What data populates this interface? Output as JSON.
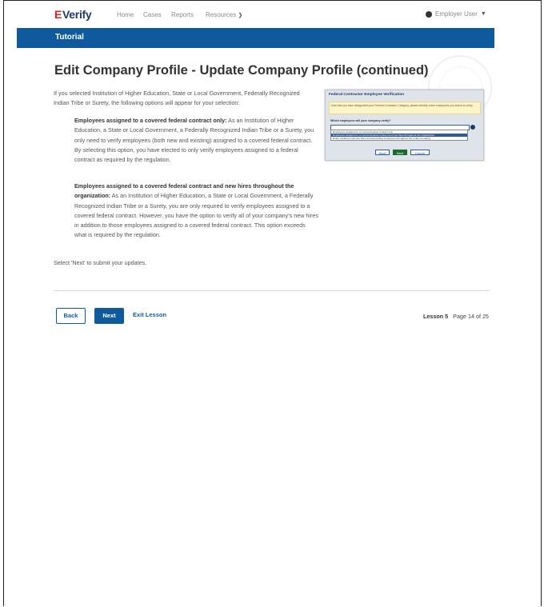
{
  "nav": {
    "logo_e": "E",
    "logo_rest": "Verify",
    "links": [
      "Home",
      "Cases",
      "Reports",
      "Resources"
    ],
    "user_label": "Employer User"
  },
  "banner": {
    "label": "Tutorial"
  },
  "page": {
    "title": "Edit Company Profile - Update Company Profile (continued)",
    "intro": "If you selected Institution of Higher Education, State or Local Government, Federally Recognized Indian Tribe or Surety, the following options will appear for your selection:",
    "option1_heading": "Employees assigned to a covered federal contract only:",
    "option1_text": " As an Institution of Higher Education, a State or Local Government, a Federally Recognized Indian Tribe or a Surety, you only need to verify employees (both new and existing) assigned to a covered federal contract. By selecting this option, you have elected to only verify employees assigned to a federal contract as required by the regulation.",
    "option2_heading": "Employees assigned to a covered federal contract and new hires throughout the organization:",
    "option2_text": " As an Institution of Higher Education, a State or Local Government, a Federally Recognized Indian Tribe or a Surety, you are only required to verify employees assigned to a covered federal contract. However, you have the option to verify all of your company's new hires in addition to those employees assigned to a covered federal contract. This option exceeds what is required by the regulation.",
    "outro": "Select 'Next' to submit your updates."
  },
  "inset": {
    "title": "Federal Contractor Employee Verification",
    "note": "Now that you have designated your Federal Contractor Category, please identify which employees you intend to verify.",
    "question": "Which employees will your company verify?",
    "options": [
      "Employees assigned to a covered federal contract only",
      "Employees assigned to a covered federal contract and new hires throughout the organization",
      "Entire workforce (all new hires and all existing employees throughout the entire company)"
    ],
    "buttons": {
      "back": "Back",
      "next": "Next",
      "cancel": "Cancel"
    }
  },
  "footer": {
    "back": "Back",
    "next": "Next",
    "exit": "Exit Lesson",
    "lesson": "Lesson 5",
    "page": "Page 14 of 25"
  }
}
